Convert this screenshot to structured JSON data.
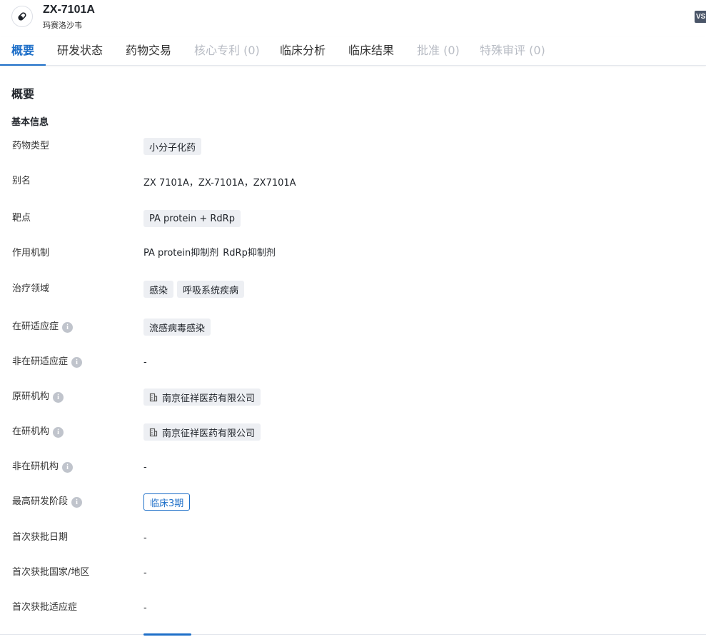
{
  "header": {
    "title": "ZX-7101A",
    "subtitle": "玛赛洛沙韦",
    "icon": "pill-icon",
    "badge": "VS"
  },
  "tabs": [
    {
      "label": "概要",
      "state": "active"
    },
    {
      "label": "研发状态",
      "state": "normal"
    },
    {
      "label": "药物交易",
      "state": "normal"
    },
    {
      "label": "核心专利 (0)",
      "state": "disabled"
    },
    {
      "label": "临床分析",
      "state": "normal"
    },
    {
      "label": "临床结果",
      "state": "normal"
    },
    {
      "label": "批准 (0)",
      "state": "disabled"
    },
    {
      "label": "特殊审评 (0)",
      "state": "disabled"
    }
  ],
  "overview": {
    "section_title": "概要",
    "basic_info_title": "基本信息",
    "drug_type": {
      "label": "药物类型",
      "tags": [
        "小分子化药"
      ]
    },
    "alias": {
      "label": "别名",
      "value": "ZX 7101A，ZX-7101A，ZX7101A"
    },
    "target": {
      "label": "靶点",
      "tags": [
        "PA protein + RdRp"
      ]
    },
    "moa": {
      "label": "作用机制",
      "items": [
        "PA protein抑制剂",
        "RdRp抑制剂"
      ]
    },
    "therapeutic_area": {
      "label": "治疗领域",
      "tags": [
        "感染",
        "呼吸系统疾病"
      ]
    },
    "active_indication": {
      "label": "在研适应症",
      "tags": [
        "流感病毒感染"
      ]
    },
    "inactive_indication": {
      "label": "非在研适应症",
      "value": "-"
    },
    "originator": {
      "label": "原研机构",
      "orgs": [
        "南京征祥医药有限公司"
      ]
    },
    "active_org": {
      "label": "在研机构",
      "orgs": [
        "南京征祥医药有限公司"
      ]
    },
    "inactive_org": {
      "label": "非在研机构",
      "value": "-"
    },
    "highest_phase": {
      "label": "最高研发阶段",
      "value": "临床3期"
    },
    "first_approval_date": {
      "label": "首次获批日期",
      "value": "-"
    },
    "first_approval_country": {
      "label": "首次获批国家/地区",
      "value": "-"
    },
    "first_approval_indication": {
      "label": "首次获批适应症",
      "value": "-"
    }
  },
  "colors": {
    "accent": "#1e6fc8",
    "tag_bg": "#edeff3",
    "disabled_text": "#b8bcc4"
  }
}
